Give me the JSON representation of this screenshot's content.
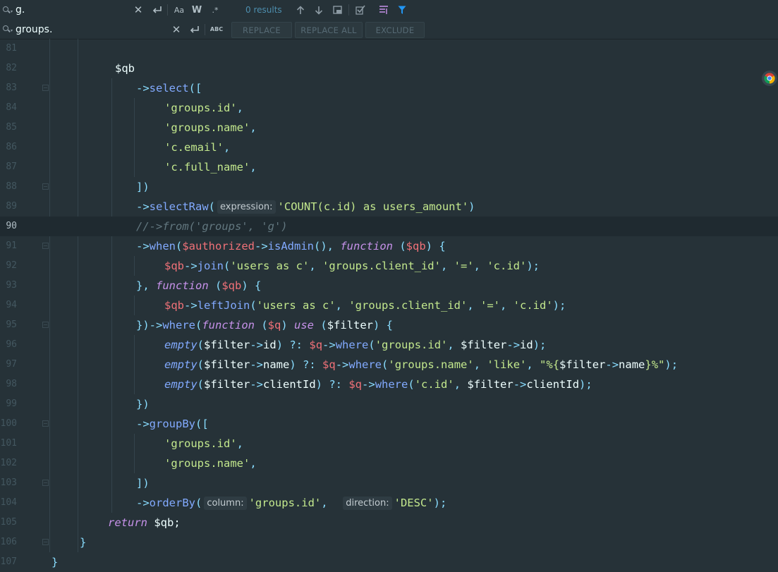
{
  "find": {
    "value": "g.",
    "results": "0 results",
    "match_case_label": "Aa",
    "words_label": "W",
    "regex_label": ".*"
  },
  "replace": {
    "value": "groups.",
    "preserve_case_label": "ABC",
    "replace_label": "REPLACE",
    "replace_all_label": "REPLACE ALL",
    "exclude_label": "EXCLUDE"
  },
  "editor": {
    "current_line": 90,
    "line_numbers": [
      "81",
      "82",
      "83",
      "84",
      "85",
      "86",
      "87",
      "88",
      "89",
      "90",
      "91",
      "92",
      "93",
      "94",
      "95",
      "96",
      "97",
      "98",
      "99",
      "100",
      "101",
      "102",
      "103",
      "104",
      "105",
      "106",
      "107"
    ],
    "lines": [
      [],
      [
        {
          "t": "$qb",
          "c": "plain"
        }
      ],
      [
        {
          "t": "->",
          "c": "op"
        },
        {
          "t": "select",
          "c": "fn"
        },
        {
          "t": "([",
          "c": "op"
        }
      ],
      [
        {
          "t": "'groups.id'",
          "c": "str"
        },
        {
          "t": ",",
          "c": "op"
        }
      ],
      [
        {
          "t": "'groups.name'",
          "c": "str"
        },
        {
          "t": ",",
          "c": "op"
        }
      ],
      [
        {
          "t": "'c.email'",
          "c": "str"
        },
        {
          "t": ",",
          "c": "op"
        }
      ],
      [
        {
          "t": "'c.full_name'",
          "c": "str"
        },
        {
          "t": ",",
          "c": "op"
        }
      ],
      [
        {
          "t": "])",
          "c": "op"
        }
      ],
      [
        {
          "t": "->",
          "c": "op"
        },
        {
          "t": "selectRaw",
          "c": "fn"
        },
        {
          "t": "(",
          "c": "op"
        },
        {
          "hint": "expression:"
        },
        {
          "t": "'COUNT(c.id) as users_amount'",
          "c": "str"
        },
        {
          "t": ")",
          "c": "op"
        }
      ],
      [
        {
          "t": "//->from('groups', 'g')",
          "c": "cmt"
        }
      ],
      [
        {
          "t": "->",
          "c": "op"
        },
        {
          "t": "when",
          "c": "fn"
        },
        {
          "t": "(",
          "c": "op"
        },
        {
          "t": "$authorized",
          "c": "var"
        },
        {
          "t": "->",
          "c": "op"
        },
        {
          "t": "isAdmin",
          "c": "fn"
        },
        {
          "t": "(), ",
          "c": "op"
        },
        {
          "t": "function",
          "c": "kw"
        },
        {
          "t": " (",
          "c": "op"
        },
        {
          "t": "$qb",
          "c": "var"
        },
        {
          "t": ") {",
          "c": "op"
        }
      ],
      [
        {
          "t": "$qb",
          "c": "var"
        },
        {
          "t": "->",
          "c": "op"
        },
        {
          "t": "join",
          "c": "fn"
        },
        {
          "t": "(",
          "c": "op"
        },
        {
          "t": "'users as c'",
          "c": "str"
        },
        {
          "t": ", ",
          "c": "op"
        },
        {
          "t": "'groups.client_id'",
          "c": "str"
        },
        {
          "t": ", ",
          "c": "op"
        },
        {
          "t": "'='",
          "c": "str"
        },
        {
          "t": ", ",
          "c": "op"
        },
        {
          "t": "'c.id'",
          "c": "str"
        },
        {
          "t": ");",
          "c": "op"
        }
      ],
      [
        {
          "t": "}, ",
          "c": "op"
        },
        {
          "t": "function",
          "c": "kw"
        },
        {
          "t": " (",
          "c": "op"
        },
        {
          "t": "$qb",
          "c": "var"
        },
        {
          "t": ") {",
          "c": "op"
        }
      ],
      [
        {
          "t": "$qb",
          "c": "var"
        },
        {
          "t": "->",
          "c": "op"
        },
        {
          "t": "leftJoin",
          "c": "fn"
        },
        {
          "t": "(",
          "c": "op"
        },
        {
          "t": "'users as c'",
          "c": "str"
        },
        {
          "t": ", ",
          "c": "op"
        },
        {
          "t": "'groups.client_id'",
          "c": "str"
        },
        {
          "t": ", ",
          "c": "op"
        },
        {
          "t": "'='",
          "c": "str"
        },
        {
          "t": ", ",
          "c": "op"
        },
        {
          "t": "'c.id'",
          "c": "str"
        },
        {
          "t": ");",
          "c": "op"
        }
      ],
      [
        {
          "t": "})->",
          "c": "op"
        },
        {
          "t": "where",
          "c": "fn"
        },
        {
          "t": "(",
          "c": "op"
        },
        {
          "t": "function",
          "c": "kw"
        },
        {
          "t": " (",
          "c": "op"
        },
        {
          "t": "$q",
          "c": "var"
        },
        {
          "t": ") ",
          "c": "op"
        },
        {
          "t": "use",
          "c": "kw"
        },
        {
          "t": " (",
          "c": "op"
        },
        {
          "t": "$filter",
          "c": "plain"
        },
        {
          "t": ") {",
          "c": "op"
        }
      ],
      [
        {
          "t": "empty",
          "c": "fnit"
        },
        {
          "t": "(",
          "c": "op"
        },
        {
          "t": "$filter",
          "c": "plain"
        },
        {
          "t": "->",
          "c": "op"
        },
        {
          "t": "id",
          "c": "plain"
        },
        {
          "t": ") ?: ",
          "c": "op"
        },
        {
          "t": "$q",
          "c": "var"
        },
        {
          "t": "->",
          "c": "op"
        },
        {
          "t": "where",
          "c": "fn"
        },
        {
          "t": "(",
          "c": "op"
        },
        {
          "t": "'groups.id'",
          "c": "str"
        },
        {
          "t": ", ",
          "c": "op"
        },
        {
          "t": "$filter",
          "c": "plain"
        },
        {
          "t": "->",
          "c": "op"
        },
        {
          "t": "id",
          "c": "plain"
        },
        {
          "t": ");",
          "c": "op"
        }
      ],
      [
        {
          "t": "empty",
          "c": "fnit"
        },
        {
          "t": "(",
          "c": "op"
        },
        {
          "t": "$filter",
          "c": "plain"
        },
        {
          "t": "->",
          "c": "op"
        },
        {
          "t": "name",
          "c": "plain"
        },
        {
          "t": ") ?: ",
          "c": "op"
        },
        {
          "t": "$q",
          "c": "var"
        },
        {
          "t": "->",
          "c": "op"
        },
        {
          "t": "where",
          "c": "fn"
        },
        {
          "t": "(",
          "c": "op"
        },
        {
          "t": "'groups.name'",
          "c": "str"
        },
        {
          "t": ", ",
          "c": "op"
        },
        {
          "t": "'like'",
          "c": "str"
        },
        {
          "t": ", ",
          "c": "op"
        },
        {
          "t": "\"%{",
          "c": "str"
        },
        {
          "t": "$filter",
          "c": "plain"
        },
        {
          "t": "->",
          "c": "op"
        },
        {
          "t": "name",
          "c": "plain"
        },
        {
          "t": "}%\"",
          "c": "str"
        },
        {
          "t": ");",
          "c": "op"
        }
      ],
      [
        {
          "t": "empty",
          "c": "fnit"
        },
        {
          "t": "(",
          "c": "op"
        },
        {
          "t": "$filter",
          "c": "plain"
        },
        {
          "t": "->",
          "c": "op"
        },
        {
          "t": "clientId",
          "c": "plain"
        },
        {
          "t": ") ?: ",
          "c": "op"
        },
        {
          "t": "$q",
          "c": "var"
        },
        {
          "t": "->",
          "c": "op"
        },
        {
          "t": "where",
          "c": "fn"
        },
        {
          "t": "(",
          "c": "op"
        },
        {
          "t": "'c.id'",
          "c": "str"
        },
        {
          "t": ", ",
          "c": "op"
        },
        {
          "t": "$filter",
          "c": "plain"
        },
        {
          "t": "->",
          "c": "op"
        },
        {
          "t": "clientId",
          "c": "plain"
        },
        {
          "t": ");",
          "c": "op"
        }
      ],
      [
        {
          "t": "})",
          "c": "op"
        }
      ],
      [
        {
          "t": "->",
          "c": "op"
        },
        {
          "t": "groupBy",
          "c": "fn"
        },
        {
          "t": "([",
          "c": "op"
        }
      ],
      [
        {
          "t": "'groups.id'",
          "c": "str"
        },
        {
          "t": ",",
          "c": "op"
        }
      ],
      [
        {
          "t": "'groups.name'",
          "c": "str"
        },
        {
          "t": ",",
          "c": "op"
        }
      ],
      [
        {
          "t": "])",
          "c": "op"
        }
      ],
      [
        {
          "t": "->",
          "c": "op"
        },
        {
          "t": "orderBy",
          "c": "fn"
        },
        {
          "t": "(",
          "c": "op"
        },
        {
          "hint": "column:"
        },
        {
          "t": "'groups.id'",
          "c": "str"
        },
        {
          "t": ",  ",
          "c": "op"
        },
        {
          "hint": "direction:"
        },
        {
          "t": "'DESC'",
          "c": "str"
        },
        {
          "t": ");",
          "c": "op"
        }
      ],
      [
        {
          "t": "return",
          "c": "kw"
        },
        {
          "t": " $qb;",
          "c": "plain"
        }
      ],
      [
        {
          "t": "}",
          "c": "op"
        }
      ],
      [
        {
          "t": "}",
          "c": "op"
        }
      ]
    ]
  }
}
